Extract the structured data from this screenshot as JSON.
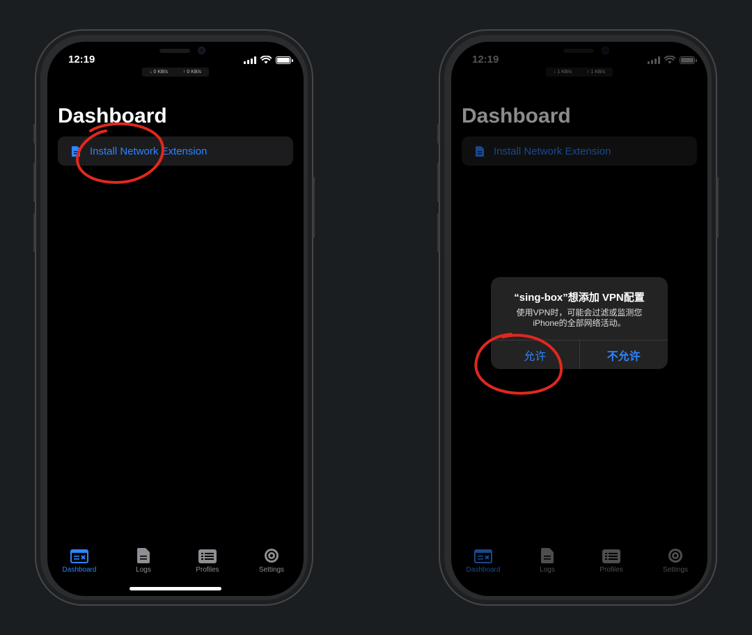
{
  "left_phone": {
    "status": {
      "time": "12:19",
      "download": "↓ 0 KB/s",
      "upload": "↑ 0 KB/s"
    },
    "page_title": "Dashboard",
    "install_label": "Install Network Extension",
    "tabs": [
      {
        "label": "Dashboard",
        "icon": "dashboard-icon",
        "active": true
      },
      {
        "label": "Logs",
        "icon": "document-icon",
        "active": false
      },
      {
        "label": "Profiles",
        "icon": "list-icon",
        "active": false
      },
      {
        "label": "Settings",
        "icon": "gear-icon",
        "active": false
      }
    ]
  },
  "right_phone": {
    "status": {
      "time": "12:19",
      "download": "↓ 1 KB/s",
      "upload": "↑ 1 KB/s"
    },
    "page_title": "Dashboard",
    "install_label": "Install Network Extension",
    "tabs": [
      {
        "label": "Dashboard",
        "icon": "dashboard-icon",
        "active": true
      },
      {
        "label": "Logs",
        "icon": "document-icon",
        "active": false
      },
      {
        "label": "Profiles",
        "icon": "list-icon",
        "active": false
      },
      {
        "label": "Settings",
        "icon": "gear-icon",
        "active": false
      }
    ],
    "alert": {
      "title": "“sing-box”想添加 VPN配置",
      "message_line1": "使用VPN时，可能会过滤或监测您",
      "message_line2": "iPhone的全部网络活动。",
      "allow": "允许",
      "deny": "不允许"
    }
  },
  "colors": {
    "accent": "#2f84ff",
    "annotation": "#e0281e",
    "background": "#1b1e21"
  }
}
